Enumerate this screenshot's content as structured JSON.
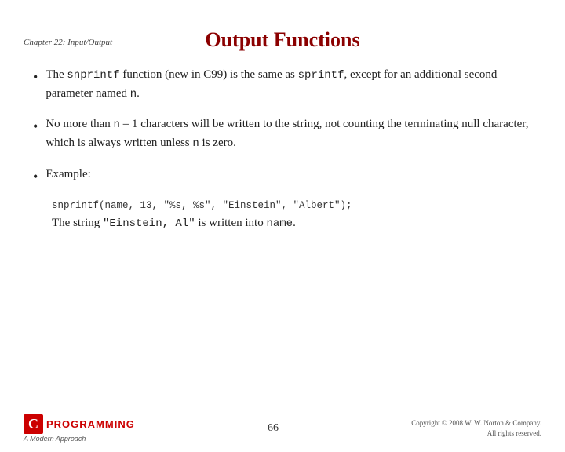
{
  "chapter": {
    "title": "Chapter 22: Input/Output"
  },
  "slide": {
    "title": "Output Functions"
  },
  "bullets": [
    {
      "id": "bullet1",
      "text_parts": [
        {
          "type": "text",
          "content": "The "
        },
        {
          "type": "code",
          "content": "snprintf"
        },
        {
          "type": "text",
          "content": " function (new in C99) is the same as "
        },
        {
          "type": "code",
          "content": "sprintf"
        },
        {
          "type": "text",
          "content": ", except for an additional second parameter named "
        },
        {
          "type": "code",
          "content": "n"
        },
        {
          "type": "text",
          "content": "."
        }
      ],
      "plain": "The snprintf function (new in C99) is the same as sprintf, except for an additional second parameter named n."
    },
    {
      "id": "bullet2",
      "text_parts": [
        {
          "type": "text",
          "content": "No more than "
        },
        {
          "type": "code",
          "content": "n"
        },
        {
          "type": "text",
          "content": " – 1 characters will be written to the string, not counting the terminating null character, which is always written unless "
        },
        {
          "type": "code",
          "content": "n"
        },
        {
          "type": "text",
          "content": " is zero."
        }
      ],
      "plain": "No more than n – 1 characters will be written to the string, not counting the terminating null character, which is always written unless n is zero."
    },
    {
      "id": "bullet3",
      "label": "Example:",
      "code_line": "snprintf(name, 13, \"%s, %s\", \"Einstein\", \"Albert\");",
      "result_text_before": "The string ",
      "result_code": "\"Einstein, Al\"",
      "result_text_after": " is written into ",
      "result_name": "name",
      "result_period": "."
    }
  ],
  "footer": {
    "page_number": "66",
    "logo_c": "C",
    "logo_programming": "PROGRAMMING",
    "logo_subtitle": "A Modern Approach",
    "copyright": "Copyright © 2008 W. W. Norton & Company.",
    "rights": "All rights reserved."
  }
}
